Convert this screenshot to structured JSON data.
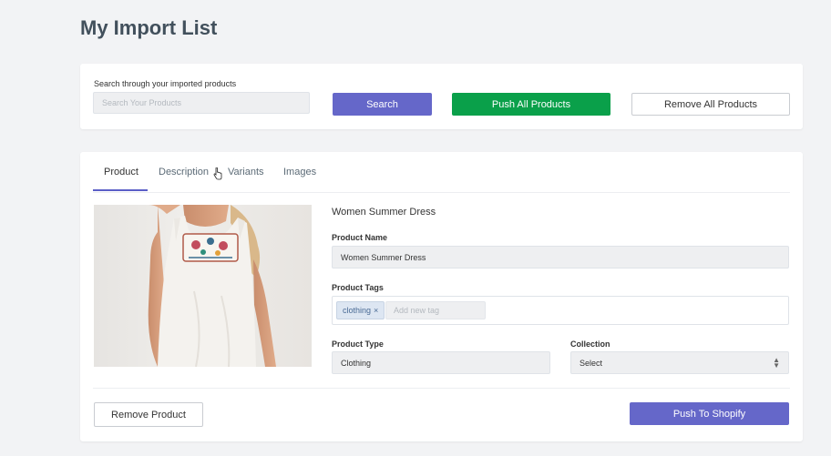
{
  "page": {
    "title": "My Import List"
  },
  "search": {
    "label": "Search through your imported products",
    "placeholder": "Search Your Products",
    "search_button": "Search",
    "push_all_button": "Push All Products",
    "remove_all_button": "Remove All Products"
  },
  "tabs": [
    {
      "label": "Product",
      "active": true
    },
    {
      "label": "Description",
      "active": false
    },
    {
      "label": "Variants",
      "active": false
    },
    {
      "label": "Images",
      "active": false
    }
  ],
  "product": {
    "title": "Women Summer Dress",
    "name_label": "Product Name",
    "name_value": "Women Summer Dress",
    "tags_label": "Product Tags",
    "tags": [
      {
        "label": "clothing",
        "remove_symbol": "×"
      }
    ],
    "tag_placeholder": "Add new tag",
    "type_label": "Product Type",
    "type_value": "Clothing",
    "collection_label": "Collection",
    "collection_value": "Select",
    "remove_button": "Remove Product",
    "push_button": "Push To Shopify"
  },
  "colors": {
    "primary": "#6567c9",
    "success": "#0aa04a",
    "page_bg": "#f2f3f5"
  }
}
